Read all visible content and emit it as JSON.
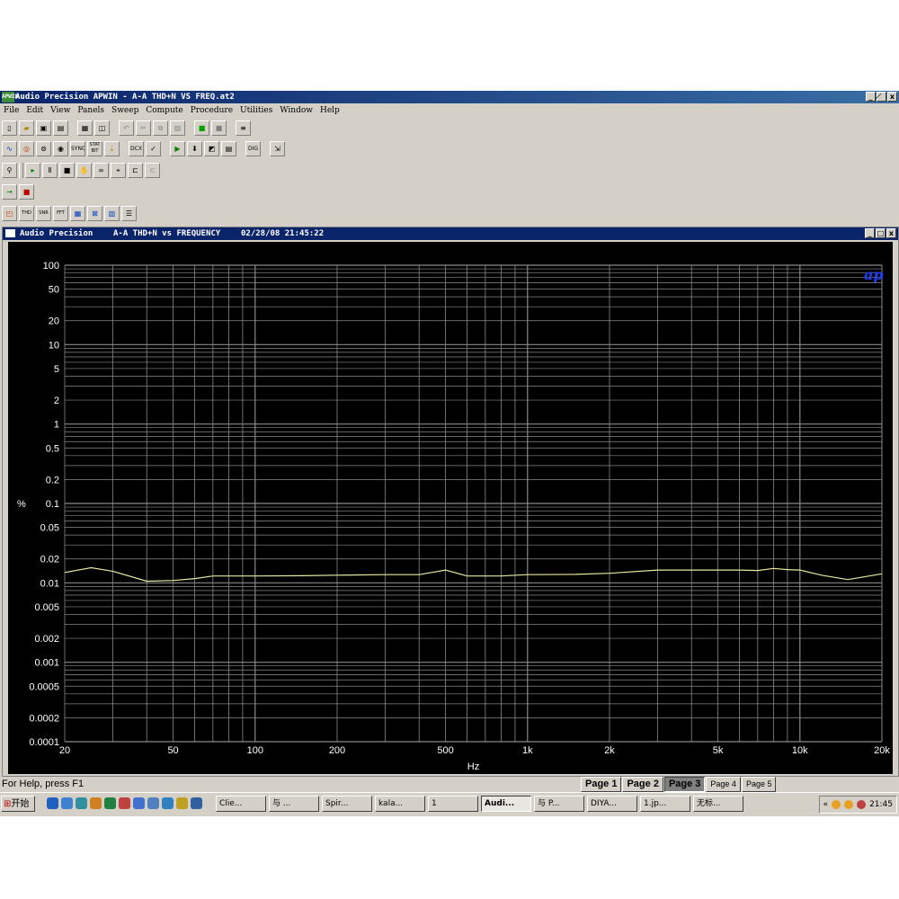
{
  "window": {
    "title": "Audio Precision APWIN - A-A THD+N VS FREQ.at2",
    "app_icon": "APWIN",
    "buttons": [
      "_",
      "̸",
      "x"
    ]
  },
  "menu": [
    "File",
    "Edit",
    "View",
    "Panels",
    "Sweep",
    "Compute",
    "Procedure",
    "Utilities",
    "Window",
    "Help"
  ],
  "toolbar1": [
    "new-icon",
    "open-icon",
    "save-icon",
    "save-all-icon",
    "print-icon",
    "print-preview-icon",
    "undo-icon",
    "cut-icon",
    "copy-icon",
    "paste-icon",
    "green-button-icon",
    "gray-button-icon",
    "notes-icon"
  ],
  "toolbar2": {
    "icons": [
      "generator-icon",
      "analyzer-icon",
      "switcher-icon",
      "dsp-icon",
      "sweep-icon"
    ],
    "labels": [
      "SYNC",
      "STAT BIT",
      "DCX",
      "DIG"
    ]
  },
  "graph": {
    "title": "Audio Precision",
    "subtitle": "A-A THD+N vs FREQUENCY",
    "timestamp": "02/28/08 21:45:22",
    "logo": "ap"
  },
  "status": {
    "help": "For Help, press F1",
    "pages": [
      "Page 1",
      "Page 2",
      "Page 3",
      "Page 4",
      "Page 5"
    ],
    "active_page": "Page 3"
  },
  "taskbar": {
    "start": "开始",
    "tasks": [
      "Clie...",
      "与 ...",
      "Spir...",
      "kala...",
      "1",
      "Audi...",
      "与 P...",
      "DIYA...",
      "1.jp...",
      "无标..."
    ],
    "active_task": "Audi...",
    "time": "21:45"
  },
  "chart_data": {
    "type": "line",
    "title": "A-A THD+N vs FREQUENCY",
    "xlabel": "Hz",
    "ylabel": "%",
    "xscale": "log",
    "yscale": "log",
    "xlim": [
      20,
      20000
    ],
    "ylim": [
      0.0001,
      100
    ],
    "x_tick_labels": [
      "20",
      "50",
      "100",
      "200",
      "500",
      "1k",
      "2k",
      "5k",
      "10k",
      "20k"
    ],
    "y_tick_labels": [
      "100",
      "50",
      "20",
      "10",
      "5",
      "2",
      "1",
      "0.5",
      "0.2",
      "0.1",
      "0.05",
      "0.02",
      "0.01",
      "0.005",
      "0.002",
      "0.001",
      "0.0005",
      "0.0002",
      "0.0001"
    ],
    "grid": true,
    "series": [
      {
        "color": "#e8e8a0",
        "x": [
          20,
          25,
          30,
          40,
          50,
          60,
          70,
          80,
          100,
          150,
          200,
          300,
          400,
          500,
          600,
          700,
          800,
          1000,
          1500,
          2000,
          3000,
          5000,
          6000,
          7000,
          8000,
          9000,
          10000,
          12000,
          15000,
          20000
        ],
        "y": [
          0.0135,
          0.0155,
          0.014,
          0.0105,
          0.0107,
          0.0113,
          0.0122,
          0.0122,
          0.0122,
          0.0123,
          0.0125,
          0.0127,
          0.0127,
          0.0145,
          0.0122,
          0.0122,
          0.0122,
          0.0127,
          0.0128,
          0.0132,
          0.0145,
          0.0145,
          0.0145,
          0.0143,
          0.0152,
          0.0147,
          0.0145,
          0.0125,
          0.011,
          0.013
        ]
      }
    ]
  }
}
